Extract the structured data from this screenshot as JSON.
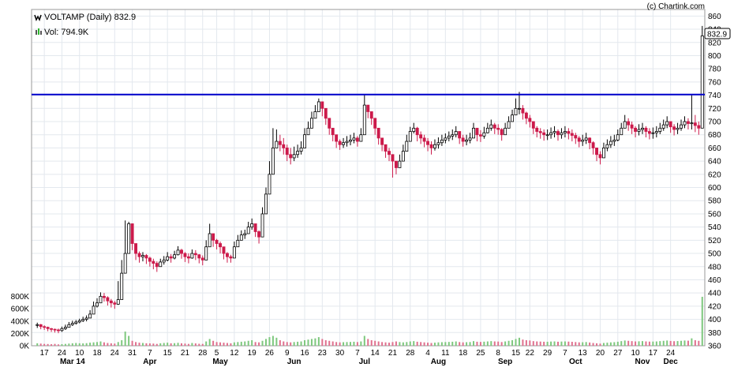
{
  "header": {
    "ticker_label": "VOLTAMP (Daily) 832.9",
    "volume_label": "Vol: 794.9K",
    "copyright": "(c) Chartink.com"
  },
  "price_badge": "832.9",
  "colors": {
    "up": "#2db52d",
    "down": "#cc1a4b",
    "candle_up_body": "#ffffff",
    "candle_down_body": "#cc1a4b",
    "line_up": "#000000",
    "vol_up": "#7ec87e",
    "vol_down": "#e0708e",
    "resistance": "#0000cc",
    "grid": "#e3e8ee",
    "frame": "#9a9a9a"
  },
  "chart_data": [
    {
      "type": "candlestick",
      "title": "VOLTAMP (Daily) 832.9",
      "ylim": [
        360,
        870
      ],
      "y_ticks": [
        360,
        380,
        400,
        420,
        440,
        460,
        480,
        500,
        520,
        540,
        560,
        580,
        600,
        620,
        640,
        660,
        680,
        700,
        720,
        740,
        760,
        780,
        800,
        820,
        840,
        860
      ],
      "x_ticks": [
        "17",
        "24",
        "10",
        "18",
        "24",
        "31",
        "7",
        "15",
        "21",
        "28",
        "5",
        "12",
        "19",
        "26",
        "9",
        "16",
        "23",
        "30",
        "7",
        "14",
        "21",
        "28",
        "4",
        "11",
        "18",
        "25",
        "8",
        "15",
        "22",
        "29",
        "7",
        "13",
        "20",
        "27",
        "10",
        "17",
        "24"
      ],
      "month_labels": [
        "Mar 14",
        "Apr",
        "May",
        "Jun",
        "Jul",
        "Aug",
        "Sep",
        "Oct",
        "Nov",
        "Dec"
      ],
      "last_close": 832.9,
      "resistance_level": 741,
      "closes": [
        392,
        389,
        388,
        386,
        385,
        384,
        383,
        386,
        388,
        392,
        394,
        396,
        398,
        400,
        402,
        408,
        420,
        425,
        435,
        433,
        428,
        425,
        423,
        430,
        470,
        500,
        545,
        515,
        500,
        495,
        497,
        493,
        488,
        485,
        480,
        487,
        490,
        495,
        493,
        498,
        505,
        500,
        495,
        493,
        500,
        498,
        493,
        490,
        510,
        530,
        520,
        515,
        510,
        500,
        495,
        493,
        510,
        520,
        528,
        530,
        540,
        545,
        533,
        525,
        560,
        590,
        620,
        660,
        670,
        665,
        660,
        650,
        645,
        650,
        655,
        660,
        680,
        690,
        705,
        715,
        730,
        720,
        705,
        690,
        680,
        670,
        665,
        668,
        670,
        672,
        675,
        670,
        680,
        725,
        715,
        705,
        690,
        675,
        665,
        655,
        650,
        640,
        630,
        640,
        655,
        670,
        685,
        690,
        680,
        675,
        670,
        665,
        660,
        665,
        668,
        672,
        675,
        678,
        680,
        685,
        675,
        670,
        672,
        675,
        690,
        680,
        678,
        683,
        690,
        695,
        690,
        688,
        680,
        690,
        700,
        710,
        720,
        720,
        713,
        705,
        700,
        690,
        685,
        683,
        680,
        680,
        683,
        685,
        680,
        683,
        685,
        682,
        679,
        675,
        670,
        672,
        675,
        668,
        660,
        650,
        645,
        660,
        665,
        670,
        672,
        680,
        690,
        700,
        695,
        690,
        685,
        688,
        690,
        685,
        682,
        683,
        685,
        690,
        695,
        700,
        692,
        688,
        690,
        695,
        700,
        697,
        698,
        694,
        690,
        830
      ],
      "highs": [
        395,
        393,
        391,
        389,
        387,
        386,
        386,
        389,
        392,
        396,
        398,
        399,
        401,
        404,
        406,
        414,
        427,
        432,
        441,
        440,
        435,
        431,
        428,
        458,
        490,
        550,
        548,
        523,
        506,
        503,
        502,
        499,
        495,
        492,
        488,
        492,
        496,
        502,
        499,
        504,
        511,
        507,
        502,
        500,
        506,
        505,
        499,
        497,
        520,
        545,
        530,
        522,
        518,
        508,
        502,
        498,
        518,
        528,
        535,
        536,
        548,
        553,
        540,
        535,
        570,
        600,
        640,
        690,
        688,
        680,
        675,
        665,
        660,
        662,
        665,
        670,
        690,
        700,
        715,
        725,
        735,
        730,
        715,
        700,
        690,
        680,
        673,
        675,
        678,
        680,
        683,
        678,
        690,
        740,
        725,
        715,
        700,
        685,
        675,
        665,
        660,
        650,
        640,
        650,
        665,
        680,
        692,
        698,
        692,
        685,
        680,
        675,
        670,
        673,
        676,
        680,
        682,
        685,
        688,
        693,
        685,
        680,
        680,
        683,
        698,
        690,
        687,
        692,
        698,
        703,
        698,
        696,
        690,
        698,
        708,
        718,
        735,
        745,
        725,
        715,
        710,
        700,
        693,
        690,
        688,
        688,
        691,
        693,
        688,
        690,
        693,
        690,
        688,
        683,
        678,
        680,
        683,
        676,
        670,
        660,
        655,
        668,
        673,
        678,
        680,
        688,
        698,
        710,
        705,
        700,
        693,
        696,
        698,
        693,
        690,
        691,
        693,
        698,
        703,
        708,
        700,
        696,
        698,
        703,
        708,
        705,
        740,
        710,
        700,
        845
      ],
      "lows": [
        387,
        385,
        384,
        382,
        381,
        380,
        379,
        381,
        384,
        388,
        390,
        392,
        394,
        396,
        397,
        402,
        413,
        418,
        428,
        427,
        421,
        418,
        416,
        422,
        460,
        490,
        500,
        505,
        490,
        486,
        488,
        484,
        480,
        476,
        472,
        480,
        483,
        488,
        486,
        491,
        497,
        492,
        487,
        485,
        492,
        490,
        485,
        482,
        500,
        518,
        510,
        506,
        500,
        491,
        486,
        486,
        500,
        511,
        520,
        522,
        530,
        536,
        525,
        515,
        550,
        580,
        610,
        640,
        660,
        655,
        650,
        640,
        635,
        640,
        645,
        650,
        670,
        680,
        695,
        705,
        720,
        708,
        695,
        680,
        670,
        660,
        657,
        660,
        662,
        664,
        667,
        662,
        670,
        715,
        705,
        695,
        680,
        665,
        655,
        645,
        640,
        615,
        620,
        630,
        645,
        660,
        675,
        682,
        670,
        666,
        661,
        655,
        650,
        656,
        659,
        663,
        667,
        670,
        672,
        676,
        666,
        662,
        664,
        667,
        680,
        670,
        669,
        674,
        682,
        686,
        681,
        680,
        671,
        681,
        690,
        700,
        710,
        711,
        703,
        696,
        691,
        681,
        676,
        674,
        671,
        672,
        674,
        676,
        671,
        674,
        676,
        673,
        670,
        666,
        661,
        663,
        666,
        658,
        650,
        640,
        635,
        650,
        655,
        660,
        663,
        670,
        680,
        690,
        686,
        681,
        676,
        679,
        681,
        676,
        673,
        674,
        676,
        681,
        686,
        690,
        683,
        679,
        681,
        686,
        690,
        688,
        688,
        684,
        680,
        736
      ],
      "up_flags": [
        1,
        0,
        0,
        0,
        0,
        0,
        0,
        1,
        1,
        1,
        1,
        1,
        1,
        1,
        1,
        1,
        1,
        1,
        1,
        0,
        0,
        0,
        0,
        1,
        1,
        1,
        1,
        0,
        0,
        0,
        1,
        0,
        0,
        0,
        0,
        1,
        1,
        1,
        0,
        1,
        1,
        0,
        0,
        0,
        1,
        0,
        0,
        0,
        1,
        1,
        0,
        0,
        0,
        0,
        0,
        0,
        1,
        1,
        1,
        1,
        1,
        1,
        0,
        0,
        1,
        1,
        1,
        1,
        1,
        0,
        0,
        0,
        0,
        1,
        1,
        1,
        1,
        1,
        1,
        1,
        1,
        0,
        0,
        0,
        0,
        0,
        0,
        1,
        1,
        1,
        1,
        0,
        1,
        1,
        0,
        0,
        0,
        0,
        0,
        0,
        0,
        0,
        0,
        1,
        1,
        1,
        1,
        1,
        0,
        0,
        0,
        0,
        0,
        1,
        1,
        1,
        1,
        1,
        1,
        1,
        0,
        0,
        1,
        1,
        1,
        0,
        0,
        1,
        1,
        1,
        0,
        0,
        0,
        1,
        1,
        1,
        1,
        1,
        0,
        0,
        0,
        0,
        0,
        0,
        0,
        1,
        1,
        1,
        0,
        1,
        1,
        0,
        0,
        0,
        0,
        1,
        1,
        0,
        0,
        0,
        0,
        1,
        1,
        1,
        1,
        1,
        1,
        1,
        0,
        0,
        0,
        1,
        1,
        0,
        0,
        1,
        1,
        1,
        1,
        1,
        0,
        0,
        1,
        1,
        1,
        0,
        1,
        0,
        0,
        1
      ],
      "volume": {
        "ylim": [
          0,
          1000
        ],
        "y_ticks_label": [
          "0K",
          "200K",
          "400K",
          "600K",
          "800K"
        ],
        "y_ticks_value": [
          0,
          200,
          400,
          600,
          800
        ],
        "values": [
          40,
          35,
          30,
          28,
          25,
          30,
          22,
          26,
          30,
          35,
          40,
          45,
          40,
          38,
          42,
          50,
          55,
          60,
          70,
          55,
          45,
          40,
          35,
          60,
          90,
          230,
          160,
          80,
          60,
          50,
          45,
          40,
          38,
          35,
          30,
          40,
          45,
          50,
          40,
          42,
          48,
          40,
          35,
          30,
          45,
          38,
          32,
          30,
          70,
          110,
          80,
          60,
          55,
          50,
          45,
          40,
          55,
          60,
          65,
          70,
          80,
          90,
          60,
          55,
          80,
          110,
          140,
          160,
          130,
          90,
          70,
          60,
          55,
          60,
          65,
          70,
          90,
          100,
          110,
          120,
          140,
          110,
          90,
          80,
          70,
          60,
          55,
          58,
          60,
          62,
          65,
          60,
          70,
          160,
          110,
          90,
          80,
          70,
          60,
          55,
          50,
          60,
          70,
          60,
          55,
          60,
          70,
          75,
          65,
          60,
          55,
          50,
          45,
          50,
          55,
          58,
          60,
          62,
          65,
          70,
          60,
          55,
          58,
          60,
          75,
          65,
          62,
          66,
          70,
          75,
          70,
          68,
          60,
          70,
          80,
          90,
          110,
          130,
          100,
          90,
          85,
          75,
          70,
          68,
          65,
          65,
          68,
          70,
          65,
          68,
          70,
          67,
          64,
          60,
          55,
          57,
          60,
          53,
          45,
          40,
          35,
          45,
          50,
          55,
          58,
          65,
          75,
          85,
          80,
          75,
          70,
          72,
          75,
          70,
          67,
          68,
          70,
          75,
          80,
          85,
          78,
          74,
          76,
          80,
          85,
          82,
          120,
          90,
          80,
          795
        ]
      }
    }
  ]
}
